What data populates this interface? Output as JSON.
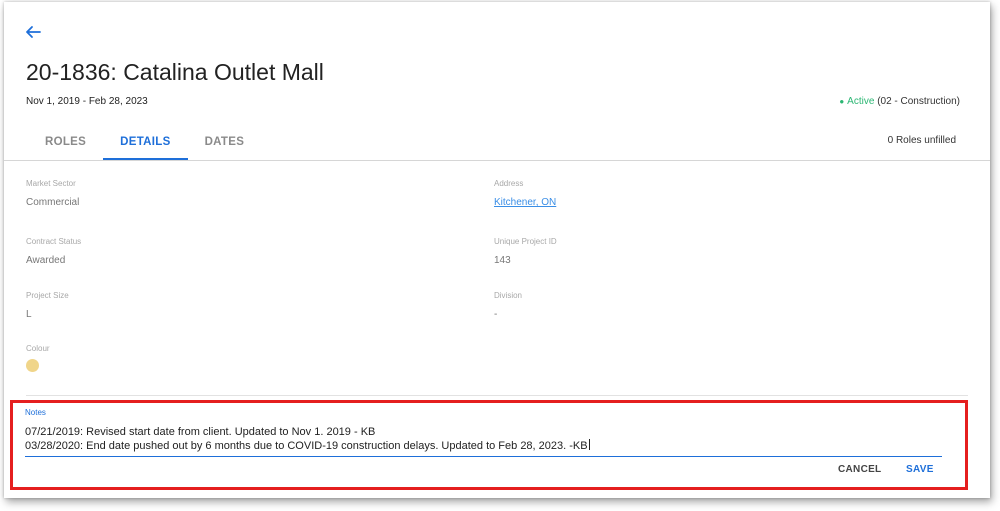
{
  "header": {
    "back_icon": "arrow-left-icon",
    "title": "20-1836: Catalina Outlet Mall",
    "date_range": "Nov 1, 2019 - Feb 28, 2023",
    "status": {
      "dot": "●",
      "active_label": "Active",
      "phase": "(02 - Construction)",
      "color": "#2bb673"
    }
  },
  "tabs": [
    {
      "label": "ROLES",
      "active": false
    },
    {
      "label": "DETAILS",
      "active": true
    },
    {
      "label": "DATES",
      "active": false
    }
  ],
  "roles_unfilled": "0 Roles unfilled",
  "details": {
    "market_sector": {
      "label": "Market Sector",
      "value": "Commercial"
    },
    "address": {
      "label": "Address",
      "value": "Kitchener, ON"
    },
    "contract_status": {
      "label": "Contract Status",
      "value": "Awarded"
    },
    "unique_project_id": {
      "label": "Unique Project ID",
      "value": "143"
    },
    "project_size": {
      "label": "Project Size",
      "value": "L"
    },
    "division": {
      "label": "Division",
      "value": "-"
    },
    "colour": {
      "label": "Colour",
      "value": "#f0d58a"
    }
  },
  "notes": {
    "label": "Notes",
    "lines": [
      "07/21/2019: Revised start date from client. Updated to Nov 1. 2019 - KB",
      "03/28/2020: End date pushed out by 6 months due to COVID-19 construction delays. Updated to Feb 28, 2023. -KB"
    ]
  },
  "actions": {
    "cancel_label": "CANCEL",
    "save_label": "SAVE"
  },
  "colors": {
    "accent": "#1e6fd9",
    "highlight_frame": "#e51f1f"
  }
}
